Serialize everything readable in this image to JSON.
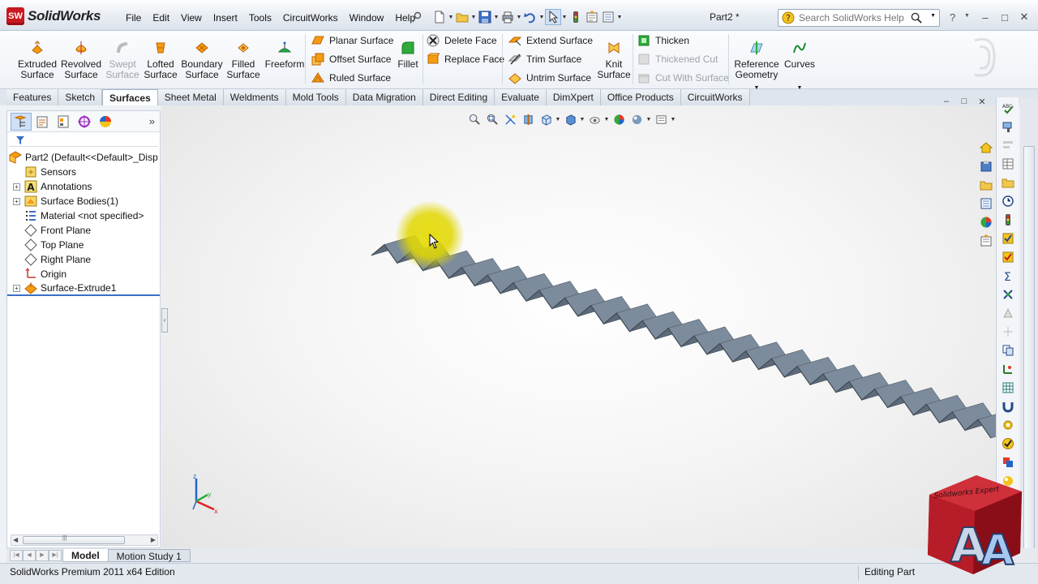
{
  "app": {
    "brand": "SolidWorks",
    "logo_mark": "SW",
    "document_title": "Part2 *"
  },
  "menu": [
    "File",
    "Edit",
    "View",
    "Insert",
    "Tools",
    "CircuitWorks",
    "Window",
    "Help"
  ],
  "search": {
    "placeholder": "Search SolidWorks Help"
  },
  "help_label": "?",
  "window_controls": {
    "minimize": "–",
    "maximize": "□",
    "close": "✕"
  },
  "ribbon": {
    "big_buttons": [
      {
        "label1": "Extruded",
        "label2": "Surface",
        "disabled": false
      },
      {
        "label1": "Revolved",
        "label2": "Surface",
        "disabled": false
      },
      {
        "label1": "Swept",
        "label2": "Surface",
        "disabled": true
      },
      {
        "label1": "Lofted",
        "label2": "Surface",
        "disabled": false
      },
      {
        "label1": "Boundary",
        "label2": "Surface",
        "disabled": false
      },
      {
        "label1": "Filled",
        "label2": "Surface",
        "disabled": false
      },
      {
        "label1": "Freeform",
        "label2": "",
        "disabled": false
      }
    ],
    "col1": [
      "Planar Surface",
      "Offset Surface",
      "Ruled Surface"
    ],
    "fillet": "Fillet",
    "col2": [
      "Delete Face",
      "Replace Face"
    ],
    "col3": [
      "Extend Surface",
      "Trim Surface",
      "Untrim Surface"
    ],
    "knit": {
      "label1": "Knit",
      "label2": "Surface"
    },
    "col4": [
      {
        "label": "Thicken",
        "disabled": false
      },
      {
        "label": "Thickened Cut",
        "disabled": true
      },
      {
        "label": "Cut With Surface",
        "disabled": true
      }
    ],
    "reference": {
      "label1": "Reference",
      "label2": "Geometry"
    },
    "curves": "Curves"
  },
  "tabs": [
    "Features",
    "Sketch",
    "Surfaces",
    "Sheet Metal",
    "Weldments",
    "Mold Tools",
    "Data Migration",
    "Direct Editing",
    "Evaluate",
    "DimXpert",
    "Office Products",
    "CircuitWorks"
  ],
  "active_tab": "Surfaces",
  "tree": {
    "root": "Part2  (Default<<Default>_Disp",
    "items": [
      {
        "label": "Sensors",
        "expand": false,
        "icon": "sensors-icon"
      },
      {
        "label": "Annotations",
        "expand": true,
        "icon": "annotations-icon"
      },
      {
        "label": "Surface Bodies(1)",
        "expand": true,
        "icon": "surface-bodies-icon"
      },
      {
        "label": "Material <not specified>",
        "expand": false,
        "icon": "material-icon"
      },
      {
        "label": "Front Plane",
        "expand": false,
        "icon": "plane-icon"
      },
      {
        "label": "Top Plane",
        "expand": false,
        "icon": "plane-icon"
      },
      {
        "label": "Right Plane",
        "expand": false,
        "icon": "plane-icon"
      },
      {
        "label": "Origin",
        "expand": false,
        "icon": "origin-icon"
      },
      {
        "label": "Surface-Extrude1",
        "expand": true,
        "icon": "surface-extrude-icon"
      }
    ]
  },
  "bottom_tabs": [
    "Model",
    "Motion Study 1"
  ],
  "status": {
    "left": "SolidWorks Premium 2011 x64 Edition",
    "right": "Editing Part"
  },
  "watermark": {
    "letter": "A",
    "text": "Solidworks Expert"
  },
  "colors": {
    "brand_red": "#c8191f",
    "surface": "#6f7d8c",
    "cursor_highlight": "#e6dc0a",
    "active_tab": "#fdfeff"
  }
}
